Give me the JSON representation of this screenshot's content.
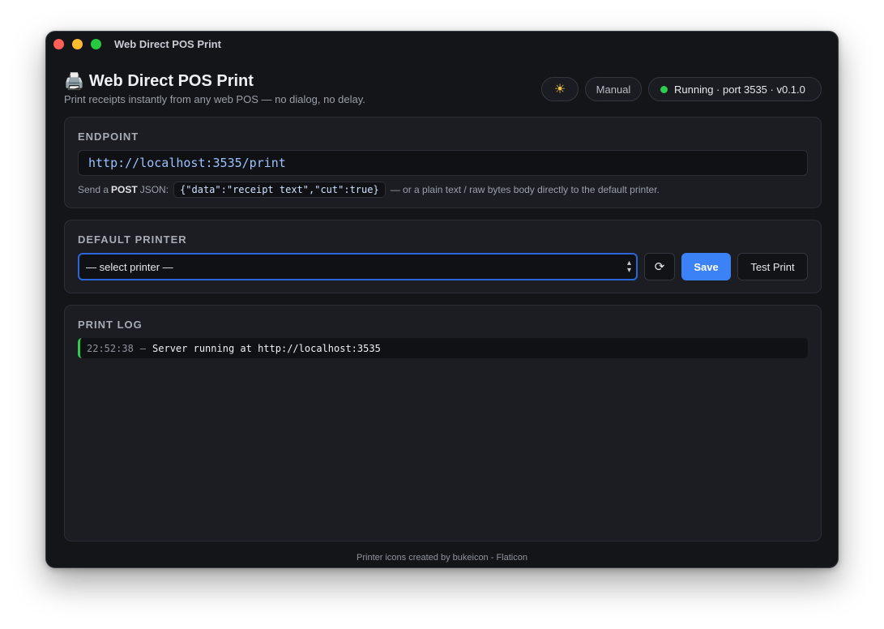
{
  "window": {
    "title": "Web Direct POS Print"
  },
  "header": {
    "title": "Web Direct POS Print",
    "subtitle": "Print receipts instantly from any web POS — no dialog, no delay.",
    "theme_icon": "sun-icon",
    "manual_label": "Manual",
    "status_text": "Running · port 3535 · v0.1.0",
    "status_color": "#2ecc4f"
  },
  "endpoint": {
    "label": "ENDPOINT",
    "url": "http://localhost:3535/print",
    "hint_prefix": "Send a",
    "hint_method": "POST",
    "hint_json_word": "JSON:",
    "hint_example": "{\"data\":\"receipt text\",\"cut\":true}",
    "hint_suffix": "— or a plain text / raw bytes body directly to the default printer."
  },
  "printer": {
    "label": "DEFAULT PRINTER",
    "selected": "— select printer —",
    "save_label": "Save",
    "test_label": "Test Print",
    "accent": "#3b82f6"
  },
  "log": {
    "label": "PRINT LOG",
    "entries": [
      {
        "time": "22:52:38",
        "sep": "–",
        "message": "Server running at http://localhost:3535"
      }
    ]
  },
  "footer": {
    "credit": "Printer icons created by bukeicon - Flaticon"
  }
}
